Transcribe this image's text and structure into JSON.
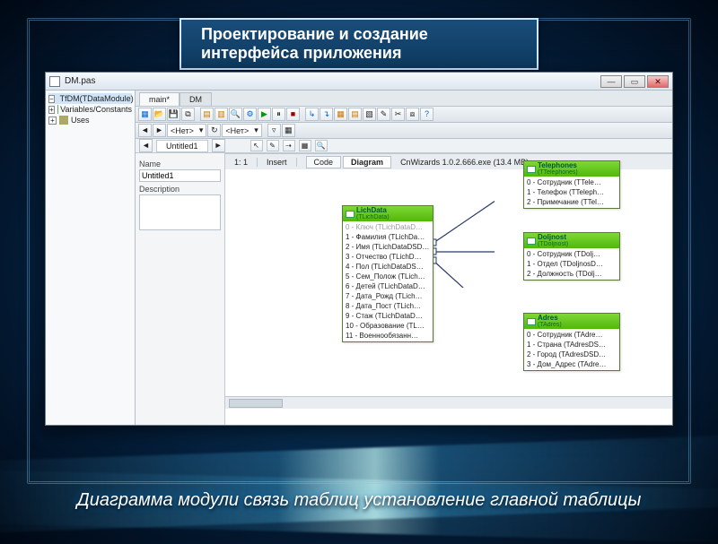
{
  "slide": {
    "title": "Проектирование и создание интерфейса приложения",
    "caption": "Диаграмма модули связь таблиц установление  главной таблицы"
  },
  "window": {
    "title": "DM.pas",
    "min": "—",
    "max": "▭",
    "close": "✕"
  },
  "project_tree": {
    "items": [
      {
        "label": "TfDM(TDataModule)",
        "icon": "mod"
      },
      {
        "label": "Variables/Constants",
        "icon": "var"
      },
      {
        "label": "Uses",
        "icon": "use"
      }
    ]
  },
  "doc_tabs": {
    "active": "main*",
    "other": "DM"
  },
  "toolbar_dropdowns": {
    "left": "<Нет>",
    "right": "<Нет>"
  },
  "sub_tab": "Untitled1",
  "inspector": {
    "name_lbl": "Name",
    "name_val": "Untitled1",
    "desc_lbl": "Description",
    "desc_val": ""
  },
  "nodes": {
    "lich": {
      "title": "LichData",
      "class": "(TLichData)",
      "rows": [
        "0 - Ключ (TLichDataD…",
        "1 - Фамилия (TLichDa…",
        "2 - Имя (TLichDataDSD…",
        "3 - Отчество (TLichD…",
        "4 - Пол (TLichDataDS…",
        "5 - Сем_Полож (TLich…",
        "6 - Детей (TLichDataD…",
        "7 - Дата_Рожд (TLich…",
        "8 - Дата_Пост (TLich…",
        "9 - Стаж (TLichDataD…",
        "10 - Образование (TL…",
        "11 - Военнообязанн…"
      ]
    },
    "tel": {
      "title": "Telephones",
      "class": "(TTelephones)",
      "rows": [
        "0 - Сотрудник (TTele…",
        "1 - Телефон (TTeleph…",
        "2 - Примечание (TTel…"
      ]
    },
    "dol": {
      "title": "Doljnost",
      "class": "(TDoljnost)",
      "rows": [
        "0 - Сотрудник (TDolj…",
        "1 - Отдел (TDoljnosD…",
        "2 - Должность (TDolj…"
      ]
    },
    "adr": {
      "title": "Adres",
      "class": "(TAdres)",
      "rows": [
        "0 - Сотрудник (TAdre…",
        "1 - Страна (TAdresDS…",
        "2 - Город (TAdresDSD…",
        "3 - Дом_Адрес (TAdre…"
      ]
    }
  },
  "statusbar": {
    "pos": "1: 1",
    "mode": "Insert",
    "tabs": {
      "code": "Code",
      "diagram": "Diagram"
    },
    "engine": "CnWizards 1.0.2.666.exe (13.4 MB)"
  }
}
